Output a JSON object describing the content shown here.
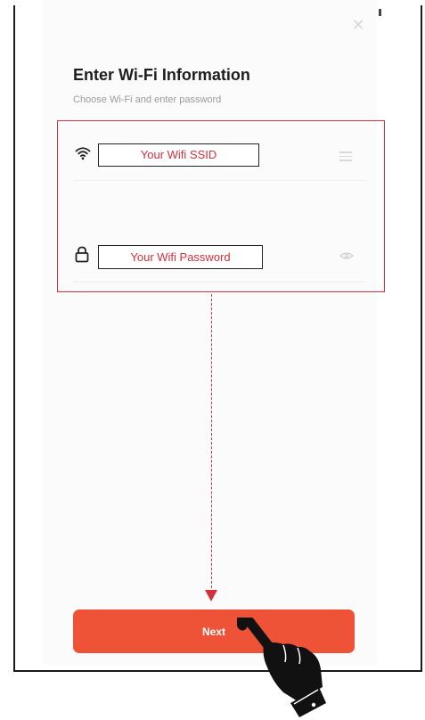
{
  "header": {
    "title": "Enter Wi-Fi Information",
    "subtitle": "Choose Wi-Fi and enter password"
  },
  "form": {
    "ssid_label": "Your Wifi SSID",
    "password_label": "Your Wifi Password"
  },
  "actions": {
    "next_label": "Next"
  },
  "icons": {
    "close": "close-icon",
    "wifi": "wifi-icon",
    "lock": "lock-icon",
    "wifi_list": "list-icon",
    "password_visibility": "eye-icon",
    "pointer": "pointing-hand-icon"
  },
  "colors": {
    "accent_button": "#ee5338",
    "annotation_red": "#d3303b"
  }
}
